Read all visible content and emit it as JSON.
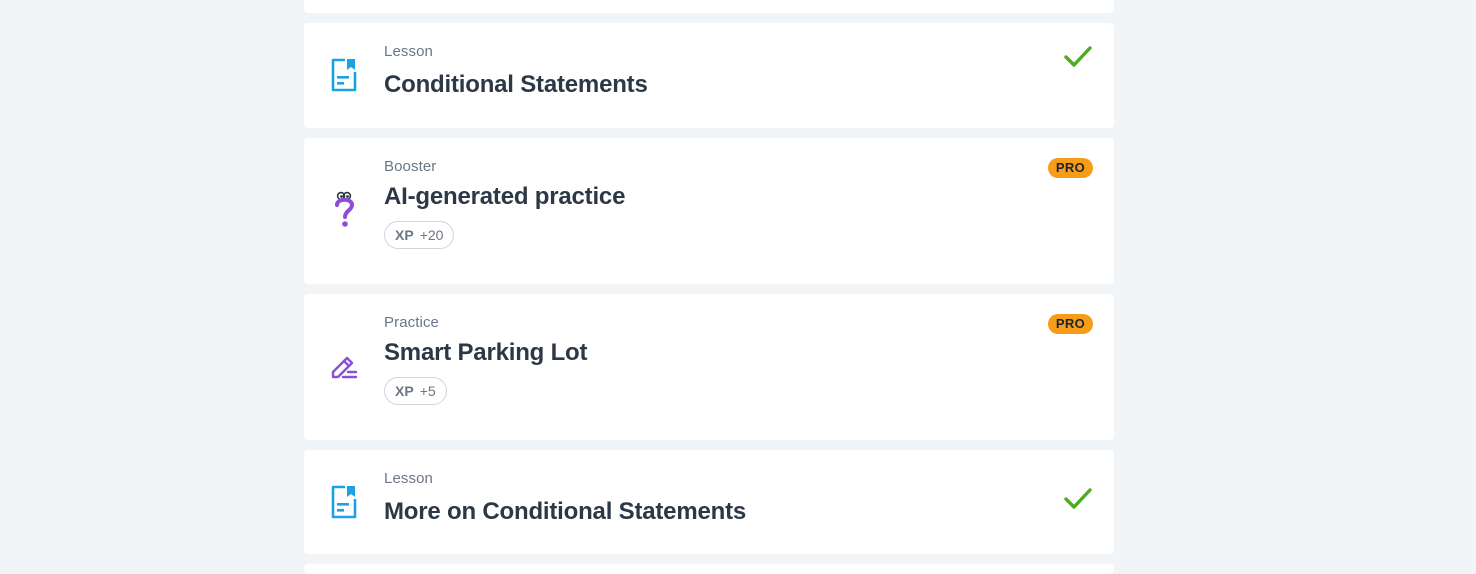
{
  "cards": [
    {
      "type": "Lesson",
      "title": "Conditional Statements",
      "icon": "lesson-doc-icon",
      "status": "completed"
    },
    {
      "type": "Booster",
      "title": "AI-generated practice",
      "icon": "question-mark-icon",
      "badge": "PRO",
      "xp_label": "XP",
      "xp_value": "+20"
    },
    {
      "type": "Practice",
      "title": "Smart Parking Lot",
      "icon": "pencil-icon",
      "badge": "PRO",
      "xp_label": "XP",
      "xp_value": "+5"
    },
    {
      "type": "Lesson",
      "title": "More on Conditional Statements",
      "icon": "lesson-doc-icon",
      "status": "completed"
    }
  ],
  "colors": {
    "background": "#f2f5f7",
    "lesson_icon": "#1da1e5",
    "booster_icon": "#8a4fd6",
    "practice_icon": "#8a4fd6",
    "check": "#4bae1f",
    "pro_badge": "#f59d18"
  }
}
